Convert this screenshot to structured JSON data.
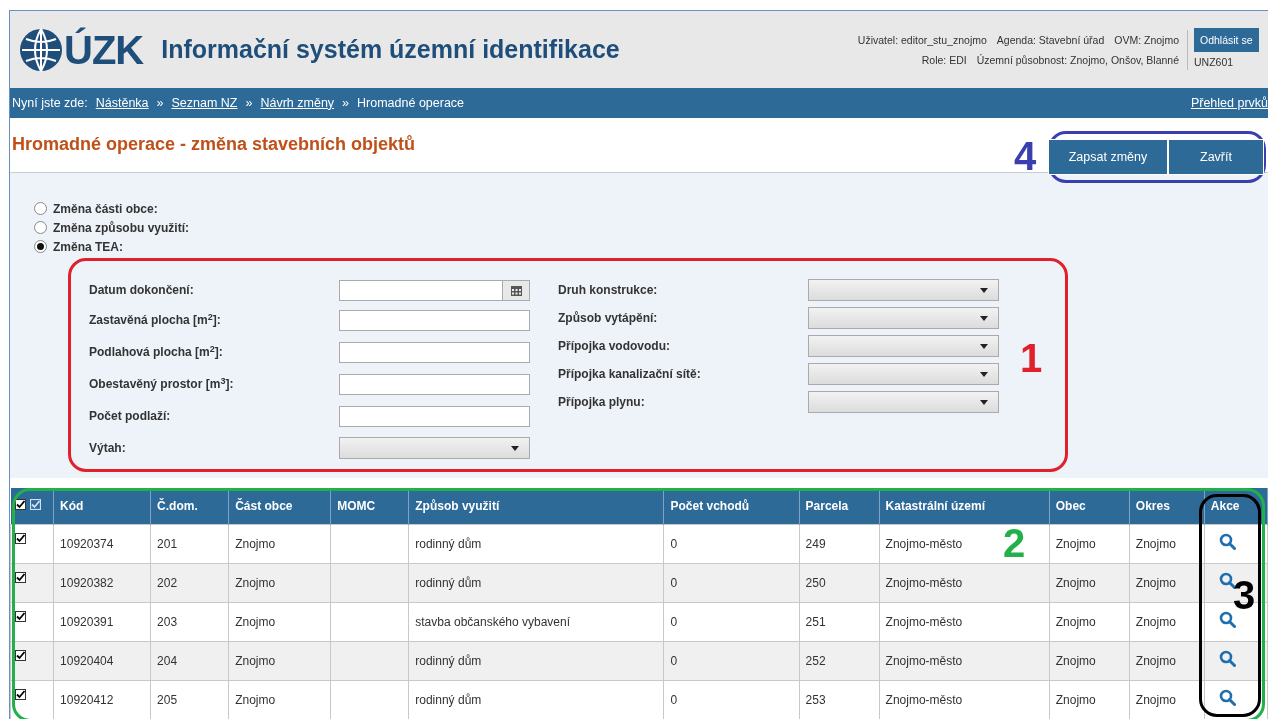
{
  "header": {
    "logo_text": "ÚZK",
    "title": "Informační systém územní identifikace",
    "user_info": [
      {
        "text": "Uživatel: editor_stu_znojmo"
      },
      {
        "text": "Agenda: Stavební úřad"
      },
      {
        "text": "OVM: Znojmo"
      }
    ],
    "user_info_2": [
      {
        "text": "Role: EDI"
      },
      {
        "text": "Územní působnost: Znojmo, Onšov, Blanné"
      }
    ],
    "logout_button": "Odhlásit se",
    "station": "UNZ601"
  },
  "breadcrumb": {
    "prefix": "Nyní jste zde:",
    "items": [
      {
        "label": "Nástěnka",
        "link": true
      },
      {
        "label": "Seznam NZ",
        "link": true
      },
      {
        "label": "Návrh změny",
        "link": true
      },
      {
        "label": "Hromadné operace",
        "link": false
      }
    ],
    "separator": "»",
    "right_link": "Přehled prvků"
  },
  "page_title": "Hromadné operace - změna stavebních objektů",
  "buttons": [
    "Zapsat změny",
    "Zavřít"
  ],
  "radios": [
    {
      "label": "Změna části obce:",
      "selected": false
    },
    {
      "label": "Změna způsobu využití:",
      "selected": false
    },
    {
      "label": "Změna TEA:",
      "selected": true
    }
  ],
  "fields_left": [
    {
      "label": "Datum dokončení:",
      "kind": "date"
    },
    {
      "label": "Zastavěná plocha [m$^{2}$]:",
      "kind": "text"
    },
    {
      "label": "Podlahová plocha [m$^{2}$]:",
      "kind": "text"
    },
    {
      "label": "Obestavěný prostor [m$^{3}$]:",
      "kind": "text"
    },
    {
      "label": "Počet podlaží:",
      "kind": "text"
    },
    {
      "label": "Výtah:",
      "kind": "select"
    }
  ],
  "fields_right": [
    {
      "label": "Druh konstrukce:",
      "kind": "select"
    },
    {
      "label": "Způsob vytápění:",
      "kind": "select"
    },
    {
      "label": "Přípojka vodovodu:",
      "kind": "select"
    },
    {
      "label": "Přípojka kanalizační sítě:",
      "kind": "select"
    },
    {
      "label": "Přípojka plynu:",
      "kind": "select"
    }
  ],
  "table": {
    "header_checked": true,
    "columns": [
      "Kód",
      "Č.dom.",
      "Část obce",
      "MOMC",
      "Způsob využití",
      "Počet vchodů",
      "Parcela",
      "Katastrální území",
      "Obec",
      "Okres",
      "Akce"
    ],
    "rows": [
      {
        "checked": true,
        "cells": [
          "10920374",
          "201",
          "Znojmo",
          "",
          "rodinný dům",
          "0",
          "249",
          "Znojmo-město",
          "Znojmo",
          "Znojmo"
        ]
      },
      {
        "checked": true,
        "cells": [
          "10920382",
          "202",
          "Znojmo",
          "",
          "rodinný dům",
          "0",
          "250",
          "Znojmo-město",
          "Znojmo",
          "Znojmo"
        ]
      },
      {
        "checked": true,
        "cells": [
          "10920391",
          "203",
          "Znojmo",
          "",
          "stavba občanského vybavení",
          "0",
          "251",
          "Znojmo-město",
          "Znojmo",
          "Znojmo"
        ]
      },
      {
        "checked": true,
        "cells": [
          "10920404",
          "204",
          "Znojmo",
          "",
          "rodinný dům",
          "0",
          "252",
          "Znojmo-město",
          "Znojmo",
          "Znojmo"
        ]
      },
      {
        "checked": true,
        "cells": [
          "10920412",
          "205",
          "Znojmo",
          "",
          "rodinný dům",
          "0",
          "253",
          "Znojmo-město",
          "Znojmo",
          "Znojmo"
        ]
      }
    ]
  },
  "annotations": [
    {
      "label": "1",
      "color": "#e0202a"
    },
    {
      "label": "2",
      "color": "#22b04a"
    },
    {
      "label": "3",
      "color": "#000000"
    },
    {
      "label": "4",
      "color": "#3a3fb0"
    }
  ]
}
